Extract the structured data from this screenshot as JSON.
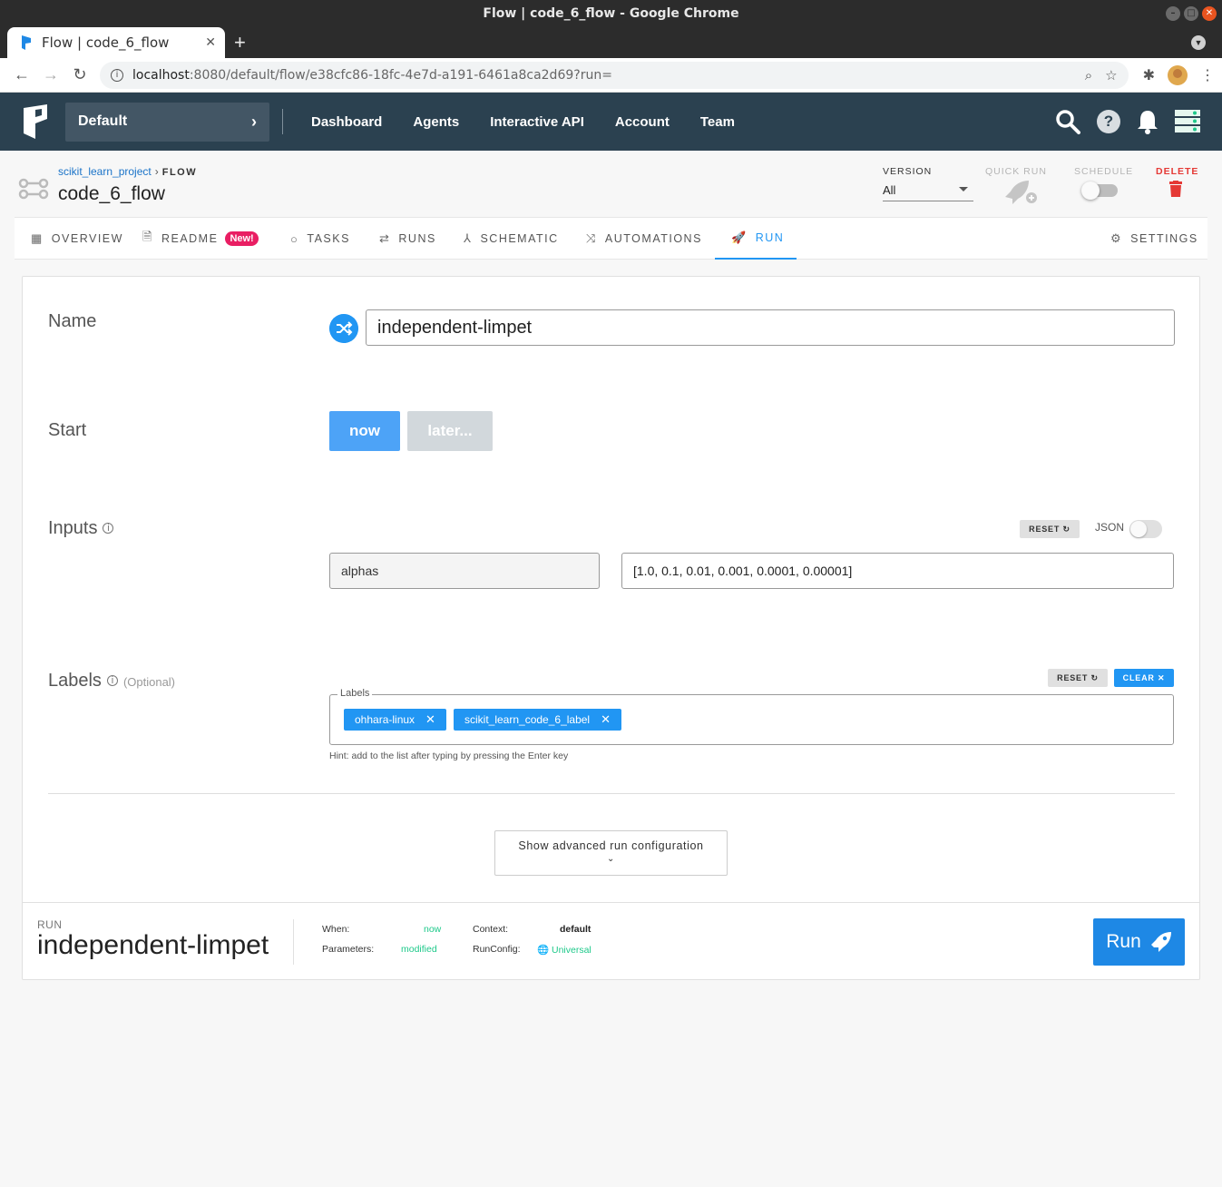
{
  "window": {
    "title": "Flow | code_6_flow - Google Chrome",
    "tab_title": "Flow | code_6_flow",
    "url_host": "localhost",
    "url_path": ":8080/default/flow/e38cfc86-18fc-4e7d-a191-6461a8ca2d69?run="
  },
  "appbar": {
    "team": "Default",
    "nav": [
      "Dashboard",
      "Agents",
      "Interactive API",
      "Account",
      "Team"
    ]
  },
  "flow": {
    "project": "scikit_learn_project",
    "kind": "FLOW",
    "name": "code_6_flow",
    "version_label": "VERSION",
    "version_value": "All",
    "quick_run_label": "QUICK RUN",
    "schedule_label": "SCHEDULE",
    "schedule_on": false,
    "delete_label": "DELETE"
  },
  "tabs": {
    "overview": "OVERVIEW",
    "readme": "README",
    "readme_badge": "New!",
    "tasks": "TASKS",
    "runs": "RUNS",
    "schematic": "SCHEMATIC",
    "automations": "AUTOMATIONS",
    "run": "RUN",
    "settings": "SETTINGS",
    "active": "run"
  },
  "form": {
    "name_label": "Name",
    "name_value": "independent-limpet",
    "start_label": "Start",
    "start_now": "now",
    "start_later": "later...",
    "inputs_label": "Inputs",
    "reset_label": "RESET",
    "json_label": "JSON",
    "json_on": false,
    "param_key": "alphas",
    "param_value": "[1.0, 0.1, 0.01, 0.001, 0.0001, 0.00001]",
    "labels_label": "Labels",
    "labels_optional": "(Optional)",
    "clear_label": "CLEAR",
    "labels_legend": "Labels",
    "labels": [
      "ohhara-linux",
      "scikit_learn_code_6_label"
    ],
    "hint": "Hint: add to the list after typing by pressing the Enter key",
    "advanced": "Show advanced run configuration"
  },
  "summary": {
    "kind": "RUN",
    "name": "independent-limpet",
    "when_key": "When:",
    "when_value": "now",
    "params_key": "Parameters:",
    "params_value": "modified",
    "context_key": "Context:",
    "context_value": "default",
    "runconfig_key": "RunConfig:",
    "runconfig_value": "Universal",
    "run_button": "Run"
  },
  "colors": {
    "primary": "#2196f3",
    "header": "#2b4150",
    "danger": "#e53935",
    "success": "#1ec98a",
    "badge": "#e91e63"
  }
}
